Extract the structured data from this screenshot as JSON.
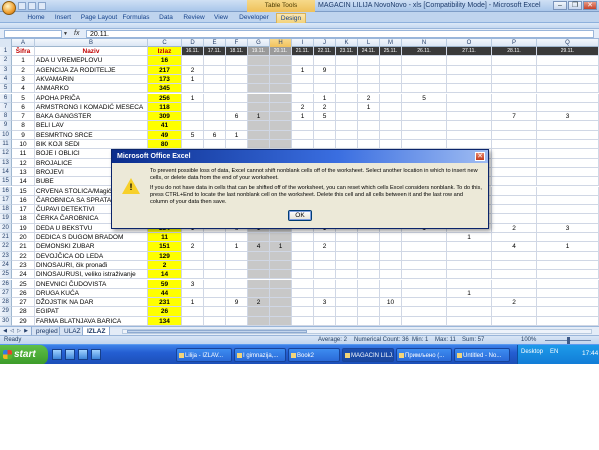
{
  "window": {
    "table_tools": "Table Tools",
    "title": "MAGACIN LILIJA NovoNovo - xls  [Compatibility Mode] - Microsoft Excel",
    "controls": [
      "–",
      "❐",
      "✕"
    ]
  },
  "ribbon": {
    "tabs": [
      "Home",
      "Insert",
      "Page Layout",
      "Formulas",
      "Data",
      "Review",
      "View",
      "Developer",
      "Design"
    ]
  },
  "formula_bar": {
    "name_box": "",
    "fx": "fx",
    "value": "20.11."
  },
  "columns": [
    "A",
    "B",
    "C",
    "D",
    "E",
    "F",
    "G",
    "H",
    "I",
    "J",
    "K",
    "L",
    "M",
    "N",
    "O",
    "P",
    "Q"
  ],
  "header_row": {
    "row": "1",
    "cells": [
      "Šifra",
      "Naziv",
      "Izlaz",
      "16.11.",
      "17.11.",
      "18.11.",
      "19.11.",
      "20.11.",
      "21.11.",
      "22.11.",
      "23.11.",
      "24.11.",
      "25.11.",
      "26.11.",
      "27.11.",
      "28.11.",
      "29.11."
    ]
  },
  "rows": [
    {
      "n": "2",
      "sifra": "1",
      "naziv": "ADA U VREMEPLOVU",
      "izlaz": "16",
      "vals": {}
    },
    {
      "n": "3",
      "sifra": "2",
      "naziv": "AGENCIJA ZA RODITELJE",
      "izlaz": "217",
      "vals": {
        "D": "2",
        "I": "1",
        "J": "9"
      }
    },
    {
      "n": "4",
      "sifra": "3",
      "naziv": "AKVAMARIN",
      "izlaz": "173",
      "vals": {
        "D": "1"
      }
    },
    {
      "n": "5",
      "sifra": "4",
      "naziv": "ANMARKO",
      "izlaz": "345",
      "vals": {}
    },
    {
      "n": "6",
      "sifra": "5",
      "naziv": "APOHA PRIČA",
      "izlaz": "256",
      "vals": {
        "D": "1",
        "J": "1",
        "L": "2",
        "N": "5"
      }
    },
    {
      "n": "7",
      "sifra": "6",
      "naziv": "ARMSTRONG I KOMADIĆ MESECA",
      "izlaz": "118",
      "vals": {
        "I": "2",
        "J": "2",
        "L": "1"
      }
    },
    {
      "n": "8",
      "sifra": "7",
      "naziv": "BAKA GANGSTER",
      "izlaz": "309",
      "vals": {
        "F": "6",
        "G": "1",
        "I": "1",
        "J": "5",
        "P": "7",
        "Q": "3"
      }
    },
    {
      "n": "9",
      "sifra": "8",
      "naziv": "BELI LAV",
      "izlaz": "41",
      "vals": {}
    },
    {
      "n": "10",
      "sifra": "9",
      "naziv": "BESMRTNO SRCE",
      "izlaz": "49",
      "vals": {
        "D": "5",
        "E": "6",
        "F": "1"
      }
    },
    {
      "n": "11",
      "sifra": "10",
      "naziv": "BIK KOJI SEDI",
      "izlaz": "80",
      "vals": {}
    },
    {
      "n": "12",
      "sifra": "11",
      "naziv": "BOJE I OBLICI",
      "izlaz": "",
      "vals": {}
    },
    {
      "n": "13",
      "sifra": "12",
      "naziv": "BROJALICE",
      "izlaz": "",
      "vals": {}
    },
    {
      "n": "14",
      "sifra": "13",
      "naziv": "BROJEVI",
      "izlaz": "",
      "vals": {}
    },
    {
      "n": "15",
      "sifra": "14",
      "naziv": "BUBE",
      "izlaz": "",
      "vals": {}
    },
    {
      "n": "16",
      "sifra": "15",
      "naziv": "CRVENA STOLICA/Magična",
      "izlaz": "",
      "vals": {}
    },
    {
      "n": "17",
      "sifra": "16",
      "naziv": "ČAROBNICA SA SPRATA N",
      "izlaz": "",
      "vals": {}
    },
    {
      "n": "18",
      "sifra": "17",
      "naziv": "ČUPAVI DETEKTIVI",
      "izlaz": "",
      "vals": {}
    },
    {
      "n": "19",
      "sifra": "18",
      "naziv": "ČERKA ČAROBNICA",
      "izlaz": "",
      "vals": {}
    },
    {
      "n": "20",
      "sifra": "19",
      "naziv": "DEDA U BEKSTVU",
      "izlaz": "234",
      "vals": {
        "D": "1",
        "F": "6",
        "G": "1",
        "J": "1",
        "N": "1",
        "P": "2",
        "Q": "3"
      }
    },
    {
      "n": "21",
      "sifra": "20",
      "naziv": "DEDICA S DUGOM BRADOM",
      "izlaz": "11",
      "vals": {
        "O": "1"
      }
    },
    {
      "n": "22",
      "sifra": "21",
      "naziv": "DEMONSKI ZUBAR",
      "izlaz": "151",
      "vals": {
        "D": "2",
        "F": "1",
        "G": "4",
        "H": "1",
        "J": "2",
        "P": "4",
        "Q": "1"
      }
    },
    {
      "n": "23",
      "sifra": "22",
      "naziv": "DEVOJČICA OD LEDA",
      "izlaz": "129",
      "vals": {}
    },
    {
      "n": "24",
      "sifra": "23",
      "naziv": "DINOSAURI, čik pronađi",
      "izlaz": "2",
      "vals": {}
    },
    {
      "n": "25",
      "sifra": "24",
      "naziv": "DINOSAURUSI, veliko istraživanje",
      "izlaz": "14",
      "vals": {}
    },
    {
      "n": "26",
      "sifra": "25",
      "naziv": "DNEVNICI ČUDOVISTA",
      "izlaz": "59",
      "vals": {
        "D": "3"
      }
    },
    {
      "n": "27",
      "sifra": "26",
      "naziv": "DRUGA KUĆA",
      "izlaz": "44",
      "vals": {
        "O": "1"
      }
    },
    {
      "n": "28",
      "sifra": "27",
      "naziv": "DŽOJSTIK NA DAR",
      "izlaz": "231",
      "vals": {
        "D": "1",
        "F": "9",
        "G": "2",
        "J": "3",
        "M": "10",
        "P": "2"
      }
    },
    {
      "n": "29",
      "sifra": "28",
      "naziv": "EGIPAT",
      "izlaz": "26",
      "vals": {}
    },
    {
      "n": "30",
      "sifra": "29",
      "naziv": "FARMA BLATNJAVA BARICA",
      "izlaz": "134",
      "vals": {}
    }
  ],
  "sheet_tabs": [
    "pregled",
    "ULAZ",
    "IZLAZ"
  ],
  "status": {
    "ready": "Ready",
    "average": "Average: 2",
    "count": "Numerical Count: 36",
    "min": "Min: 1",
    "max": "Max: 11",
    "sum": "Sum: 57",
    "zoom": "100%"
  },
  "dialog": {
    "title": "Microsoft Office Excel",
    "close": "✕",
    "icon": "warning-icon",
    "text1": "To prevent possible loss of data, Excel cannot shift nonblank cells off of the worksheet.  Select another location in which to insert new cells, or delete data from the end of your worksheet.",
    "text2": "If you do not have data in cells that can be shifted off of the worksheet, you can reset which cells Excel considers nonblank.  To do this, press CTRL+End to locate the last nonblank cell on the worksheet.  Delete this cell and all cells between it and the last row and column of your data then save.",
    "ok": "OK"
  },
  "taskbar": {
    "start": "start",
    "buttons": [
      "Lilija - IZLAV...",
      "I gimnazija,...",
      "Book2",
      "MAGACIN LILJ...",
      "Примљено (...",
      "Untitled - No..."
    ],
    "tray_desktop": "Desktop",
    "tray_lang": "EN",
    "clock": "17:44"
  },
  "colors": {
    "header_text": "#c00000",
    "izlaz_fill": "#ffff00",
    "dialog_title": "#0b2d8c"
  }
}
